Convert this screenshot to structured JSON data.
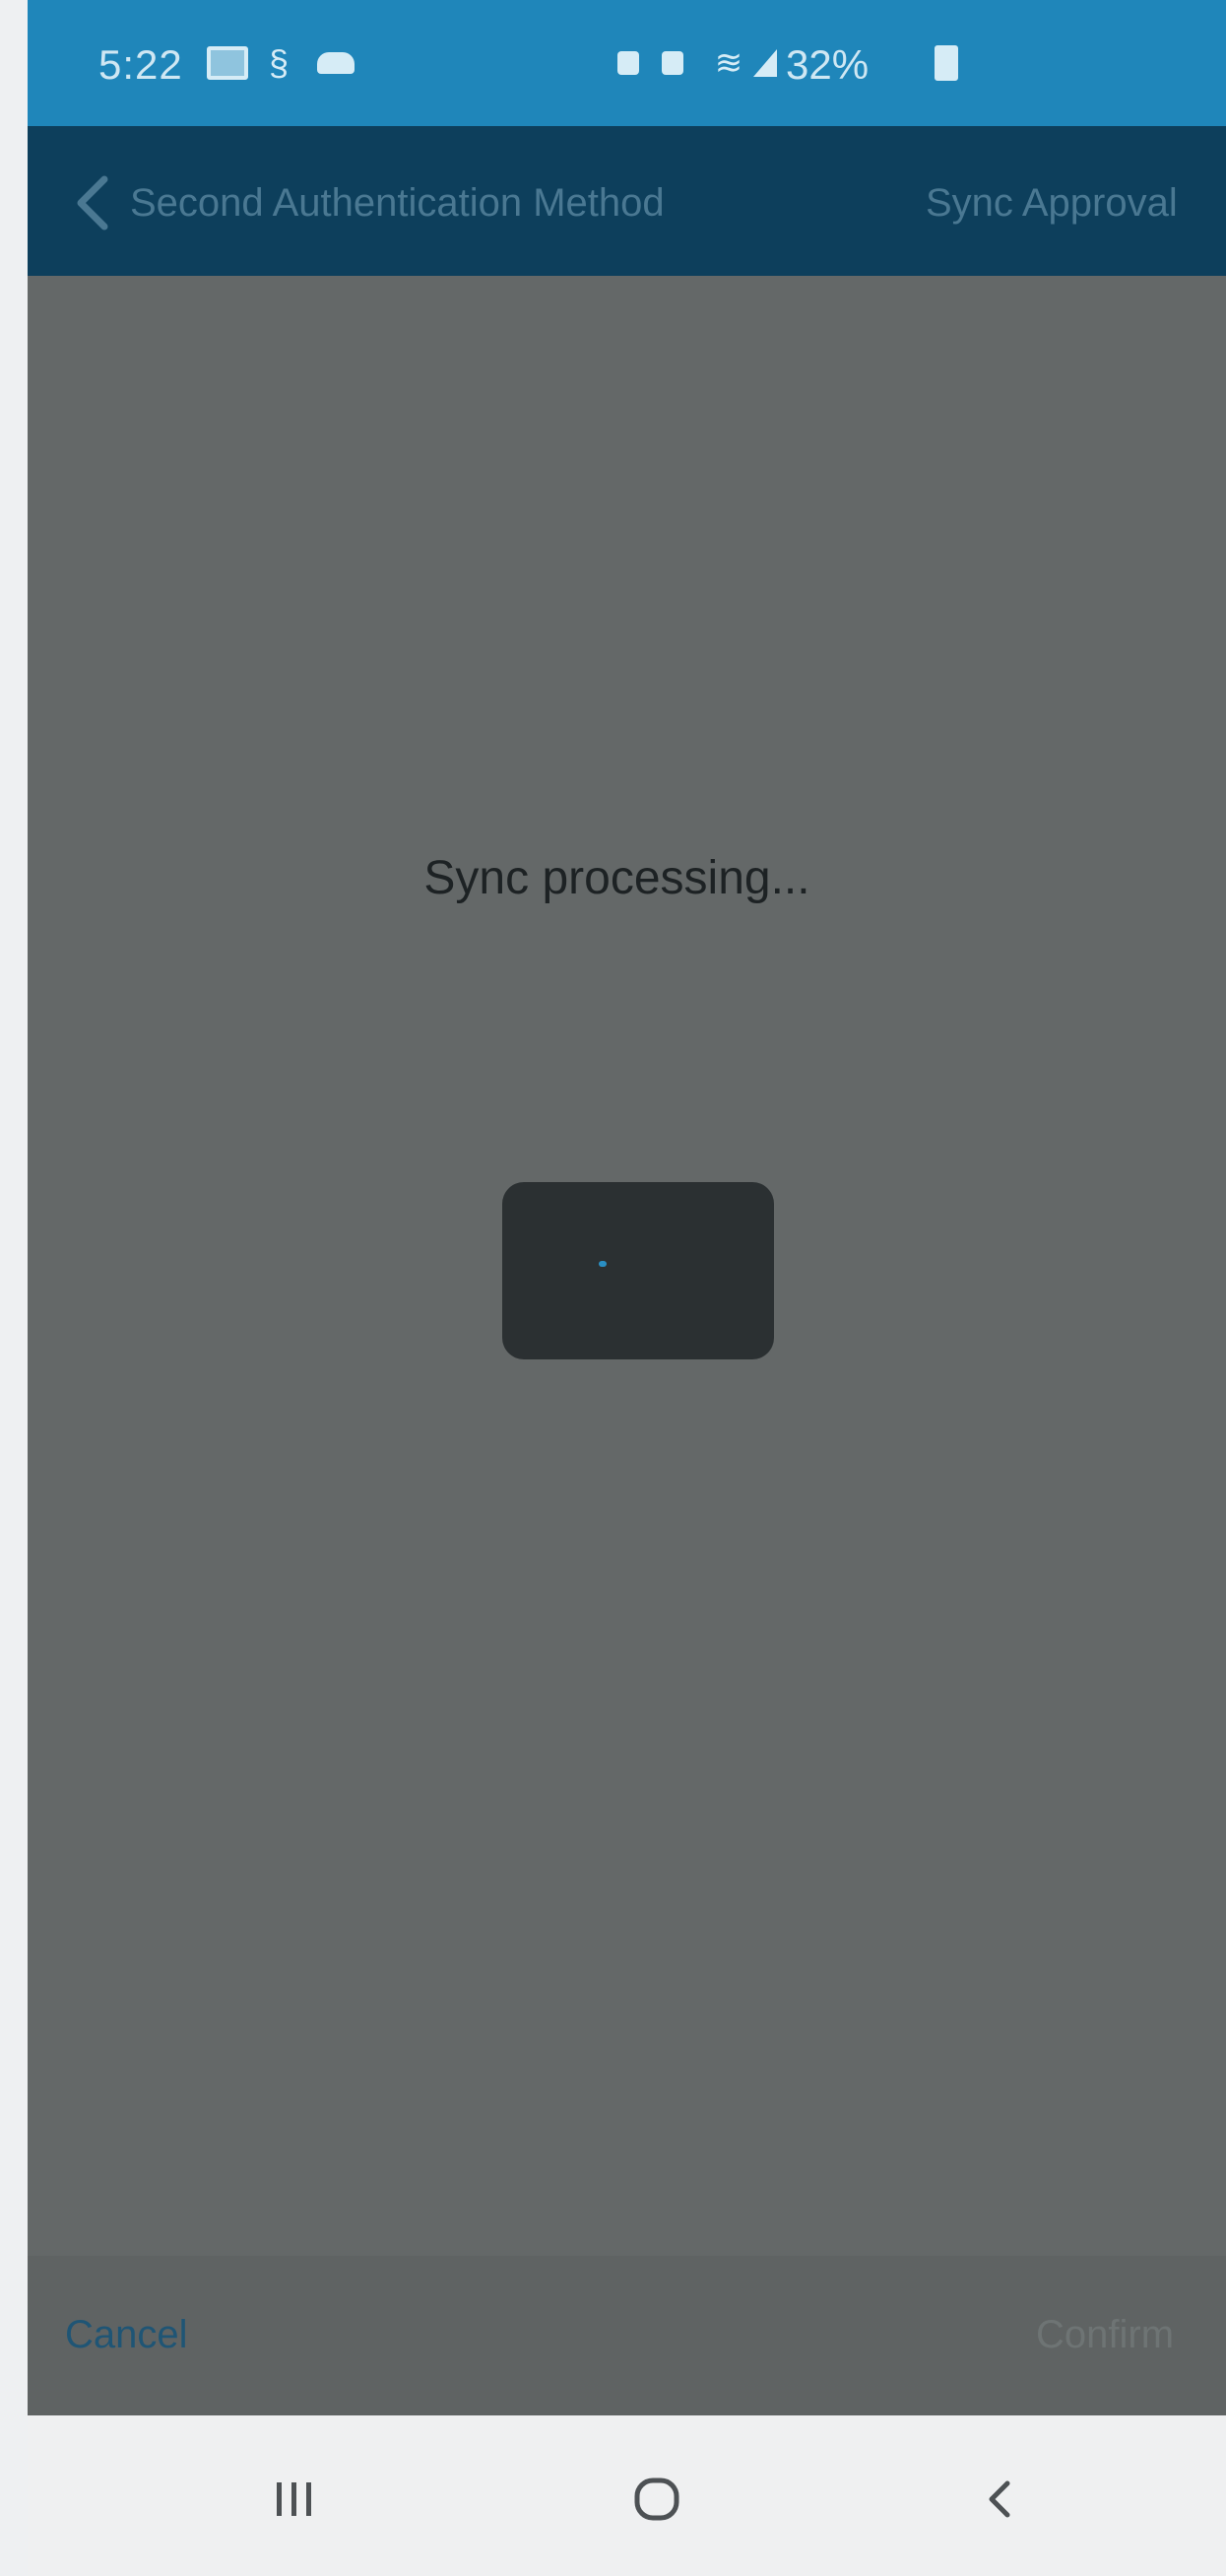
{
  "status_bar": {
    "time": "5:22",
    "battery": "32%"
  },
  "header": {
    "back_icon": "chevron-left-icon",
    "title": "Second Authentication Method",
    "step": "Sync Approval"
  },
  "main": {
    "processing_text": "Sync processing..."
  },
  "footer": {
    "cancel_label": "Cancel",
    "confirm_label": "Confirm"
  },
  "system_nav": {
    "recents_icon": "recents-icon",
    "home_icon": "home-icon",
    "back_icon": "back-icon"
  },
  "colors": {
    "status_bar": "#1f86ba",
    "header": "#0d3f5c",
    "overlay": "#646868",
    "spinner_box": "#2b3032"
  }
}
